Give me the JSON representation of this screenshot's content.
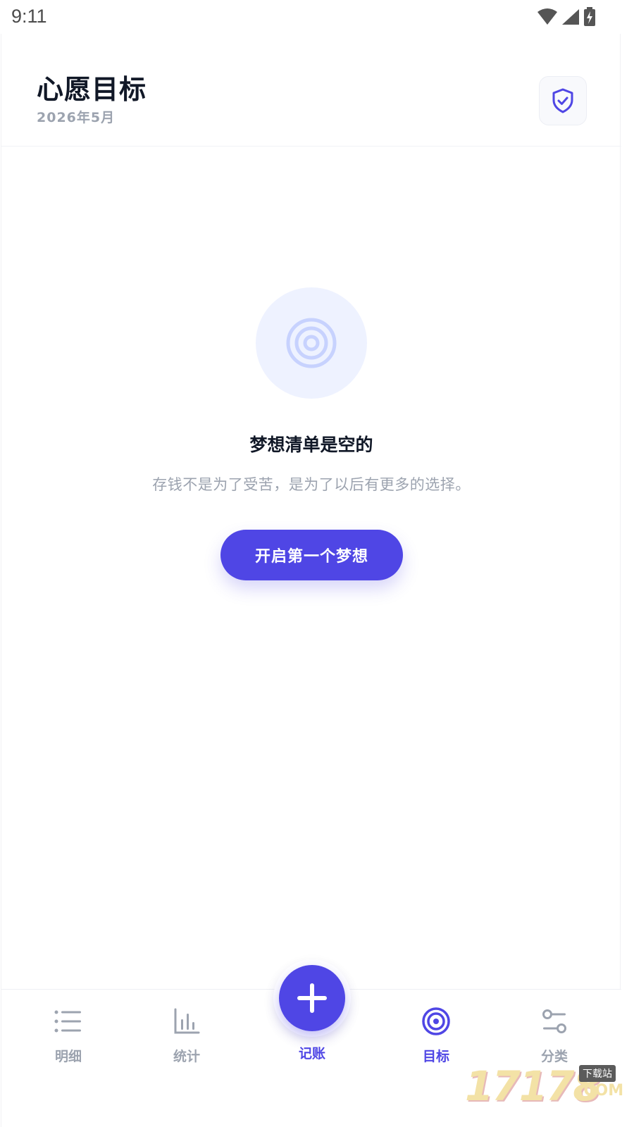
{
  "status_bar": {
    "time": "9:11"
  },
  "header": {
    "title": "心愿目标",
    "subtitle": "2026年5月"
  },
  "empty_state": {
    "title": "梦想清单是空的",
    "description": "存钱不是为了受苦，是为了以后有更多的选择。",
    "cta_label": "开启第一个梦想"
  },
  "bottom_nav": {
    "items": [
      {
        "label": "明细",
        "icon": "list-icon"
      },
      {
        "label": "统计",
        "icon": "bar-chart-icon"
      },
      {
        "label": "记账",
        "icon": "plus-icon"
      },
      {
        "label": "目标",
        "icon": "target-icon"
      },
      {
        "label": "分类",
        "icon": "sliders-icon"
      }
    ],
    "active": "目标"
  },
  "watermark": {
    "number": "17178",
    "badge": "下载站",
    "domain": ".COM"
  },
  "colors": {
    "accent": "#4f46e5",
    "muted": "#9ca3af",
    "title": "#111827",
    "empty_circle": "#eef2ff"
  }
}
